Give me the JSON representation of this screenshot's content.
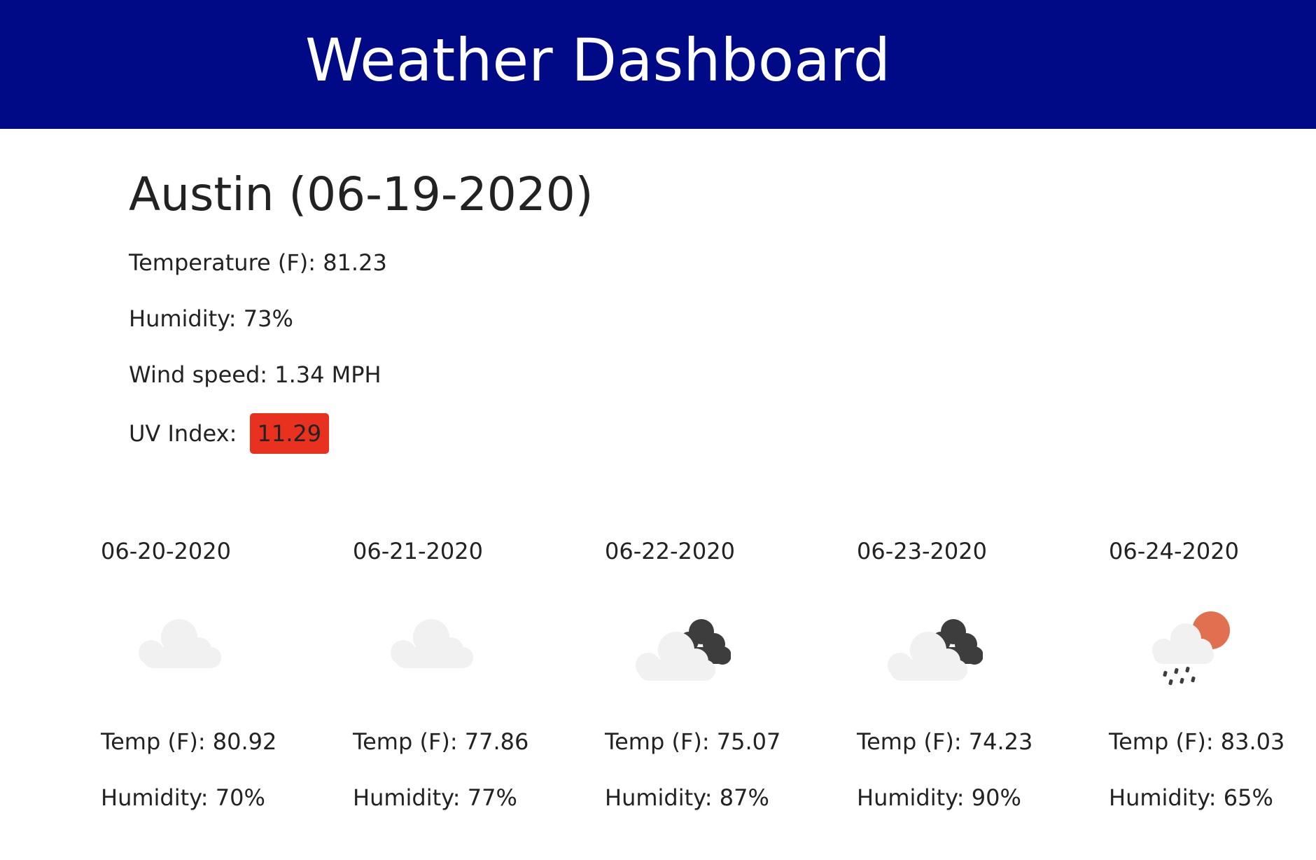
{
  "header": {
    "title": "Weather Dashboard",
    "background_color": "#000a87"
  },
  "current": {
    "title": "Austin (06-19-2020)",
    "temperature": "Temperature (F): 81.23",
    "humidity": "Humidity: 73%",
    "wind": "Wind speed: 1.34 MPH",
    "uv_label": "UV Index:",
    "uv_value": "11.29",
    "uv_color": "#e8311f"
  },
  "forecast": [
    {
      "date": "06-20-2020",
      "icon": "cloud-icon",
      "temp": "Temp (F): 80.92",
      "humidity": "Humidity: 70%"
    },
    {
      "date": "06-21-2020",
      "icon": "cloud-icon",
      "temp": "Temp (F): 77.86",
      "humidity": "Humidity: 77%"
    },
    {
      "date": "06-22-2020",
      "icon": "broken-clouds-icon",
      "temp": "Temp (F): 75.07",
      "humidity": "Humidity: 87%"
    },
    {
      "date": "06-23-2020",
      "icon": "broken-clouds-icon",
      "temp": "Temp (F): 74.23",
      "humidity": "Humidity: 90%"
    },
    {
      "date": "06-24-2020",
      "icon": "rain-sun-icon",
      "temp": "Temp (F): 83.03",
      "humidity": "Humidity: 65%"
    }
  ]
}
